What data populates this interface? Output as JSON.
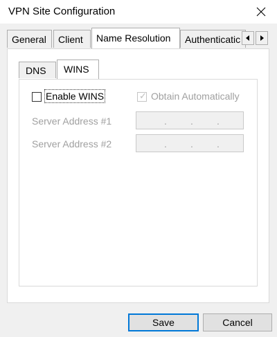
{
  "window": {
    "title": "VPN Site Configuration",
    "close_icon": "close-icon"
  },
  "tabs": [
    {
      "label": "General"
    },
    {
      "label": "Client"
    },
    {
      "label": "Name Resolution",
      "selected": true
    },
    {
      "label": "Authenticatic"
    }
  ],
  "tab_scroll": {
    "left_icon": "arrow-left-icon",
    "right_icon": "arrow-right-icon"
  },
  "subtabs": [
    {
      "label": "DNS"
    },
    {
      "label": "WINS",
      "selected": true
    }
  ],
  "wins": {
    "enable_label": "Enable WINS",
    "enable_checked": false,
    "obtain_label": "Obtain Automatically",
    "obtain_checked": true,
    "server1_label": "Server Address #1",
    "server2_label": "Server Address #2",
    "server1_value": [
      "",
      "",
      "",
      ""
    ],
    "server2_value": [
      "",
      "",
      "",
      ""
    ]
  },
  "buttons": {
    "save": "Save",
    "cancel": "Cancel"
  },
  "colors": {
    "accent": "#0078d7",
    "disabled_text": "#a0a0a0",
    "panel": "#ffffff",
    "background": "#f0f0f0"
  }
}
